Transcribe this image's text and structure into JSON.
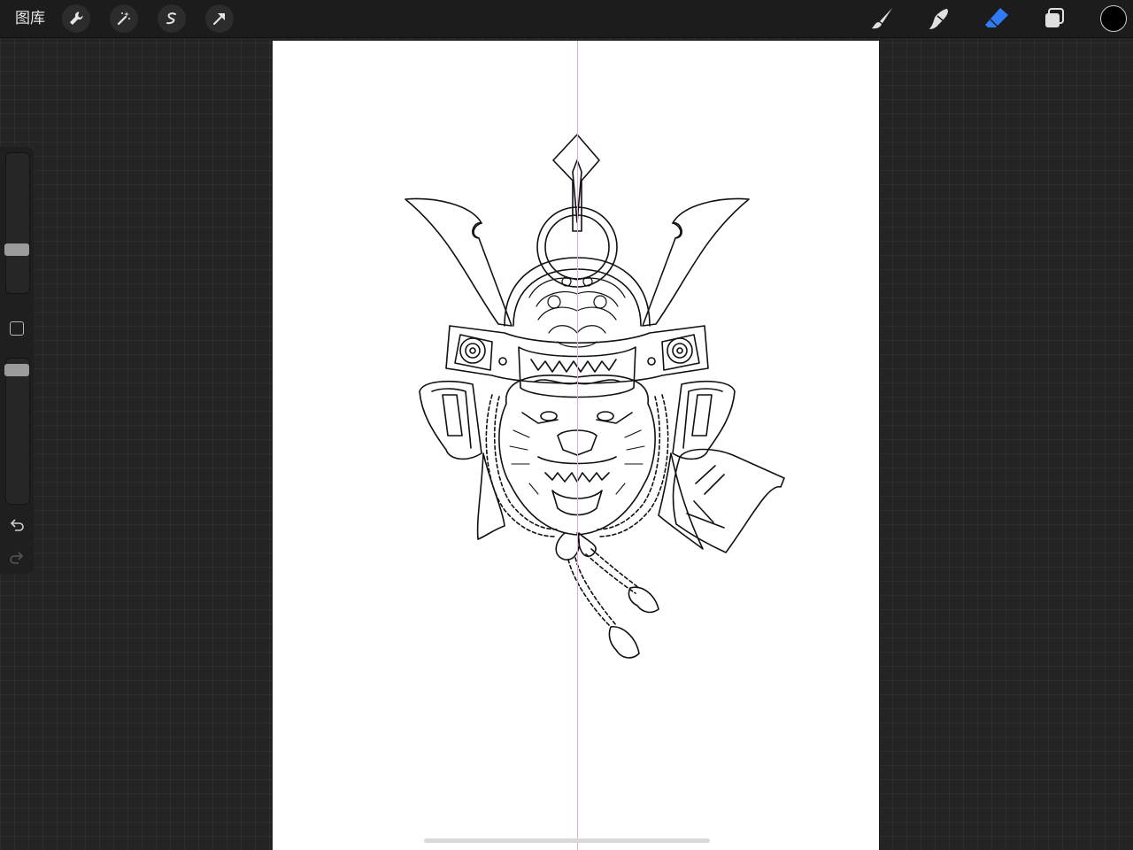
{
  "toolbar": {
    "gallery_label": "图库",
    "left_tools": [
      "actions-wrench-icon",
      "adjustments-wand-icon",
      "selection-icon",
      "transform-arrow-icon"
    ],
    "right_tools": [
      "brush-icon",
      "smudge-icon",
      "eraser-icon",
      "layers-icon"
    ],
    "active_tool": "eraser",
    "accent_color": "#2f7bf6",
    "current_color": "#000000"
  },
  "sidebar": {
    "brush_size_level": 0.5,
    "opacity_level": 0.95,
    "controls": [
      "brush-size-slider",
      "modify-button",
      "opacity-slider",
      "undo-icon",
      "redo-icon"
    ]
  },
  "canvas": {
    "background": "#ffffff",
    "drawing_guide": "vertical-symmetry",
    "guide_color": "#e6a3e8",
    "artwork": "samurai-helmet-tiger-line-art"
  }
}
